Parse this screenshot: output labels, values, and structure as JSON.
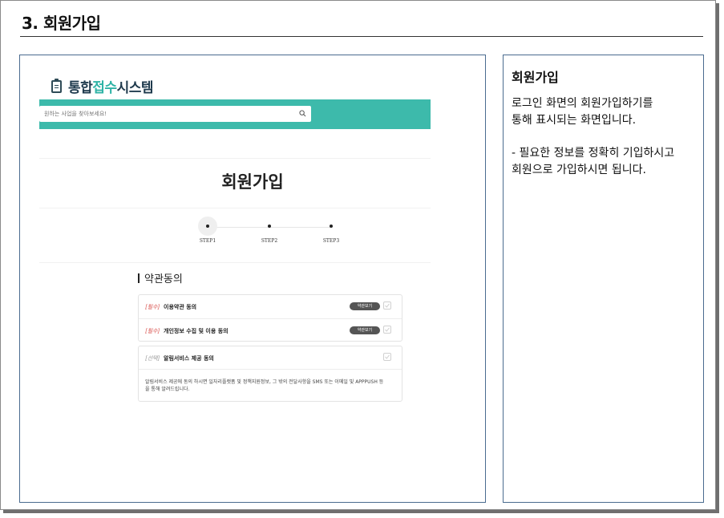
{
  "document": {
    "title": "3. 회원가입"
  },
  "description": {
    "heading": "회원가입",
    "paragraph1": "로그인 화면의 회원가입하기를\n통해 표시되는 화면입니다.",
    "paragraph2": "- 필요한 정보를 정확히 기입하시고\n 회원으로 가입하시면 됩니다."
  },
  "site": {
    "logo": {
      "icon": "clipboard-icon",
      "part1": "통합",
      "part2": "접수",
      "part3": "시스템",
      "accent_color": "#2fb3a6",
      "dark_color": "#1f3a4d"
    },
    "search": {
      "placeholder": "원하는 사업을 찾아보세요!",
      "icon": "search-icon",
      "band_color": "#3dbaab"
    },
    "page_heading": "회원가입",
    "steps": [
      {
        "label": "STEP1",
        "active": true
      },
      {
        "label": "STEP2",
        "active": false
      },
      {
        "label": "STEP3",
        "active": false
      }
    ],
    "terms": {
      "title": "약관동의",
      "required": [
        {
          "tag": "[필수]",
          "name": "이용약관 동의",
          "view_label": "약관보기",
          "checked": false
        },
        {
          "tag": "[필수]",
          "name": "개인정보 수집 및 이용 동의",
          "view_label": "약관보기",
          "checked": false
        }
      ],
      "optional": {
        "tag": "[선택]",
        "name": "알림서비스 제공 동의",
        "checked": false,
        "description": "알림서비스 제공에 동의 하시면 일자리플랫폼 및 정책지원정보, 그 밖의 전달사항을 SMS 또는 이메일 및 APPPUSH 등을 통해 알려드립니다."
      }
    }
  }
}
